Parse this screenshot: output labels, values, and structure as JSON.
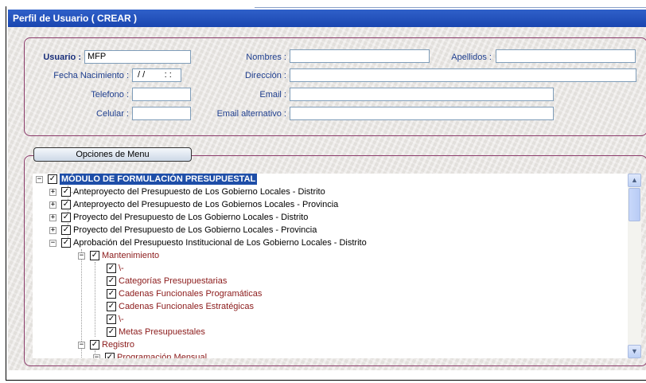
{
  "window": {
    "title": "Perfil de Usuario ( CREAR )"
  },
  "form": {
    "usuario_label": "Usuario :",
    "usuario_value": "MFP",
    "nombres_label": "Nombres :",
    "nombres_value": "",
    "apellidos_label": "Apellidos :",
    "apellidos_value": "",
    "fecha_label": "Fecha Nacimiento :",
    "fecha_value": " / /        : :",
    "direccion_label": "Dirección :",
    "direccion_value": "",
    "telefono_label": "Telefono :",
    "telefono_value": "",
    "email_label": "Email :",
    "email_value": "",
    "celular_label": "Celular :",
    "celular_value": "",
    "email_alt_label": "Email alternativo :",
    "email_alt_value": ""
  },
  "menu_tab": {
    "label": "Opciones de Menu"
  },
  "tree": {
    "root": "MÓDULO DE FORMULACIÓN PRESUPUESTAL",
    "level1": [
      "Anteproyecto del Presupuesto de Los Gobierno Locales - Distrito",
      "Anteproyecto del Presupuesto de Los Gobiernos Locales - Provincia",
      "Proyecto del Presupuesto de Los Gobierno Locales - Distrito",
      "Proyecto del Presupuesto de Los Gobierno Locales - Provincia",
      "Aprobación del Presupuesto Institucional de Los Gobierno Locales - Distrito"
    ],
    "mantenimiento": "Mantenimiento",
    "mantenimiento_items": [
      "\\-",
      "Categorías Presupuestarias",
      "Cadenas Funcionales Programáticas",
      "Cadenas Funcionales Estratégicas",
      "\\-",
      "Metas Presupuestales"
    ],
    "registro": "Registro",
    "registro_items": [
      "Programación Mensual"
    ],
    "check_glyph": "✓",
    "expand_glyph": "+",
    "collapse_glyph": "−"
  },
  "colors": {
    "title_bar": "#2f60c9",
    "panel_border": "#8b3a6a",
    "root_highlight": "#1e4ea8",
    "submenu_text": "#8b1a1a"
  }
}
